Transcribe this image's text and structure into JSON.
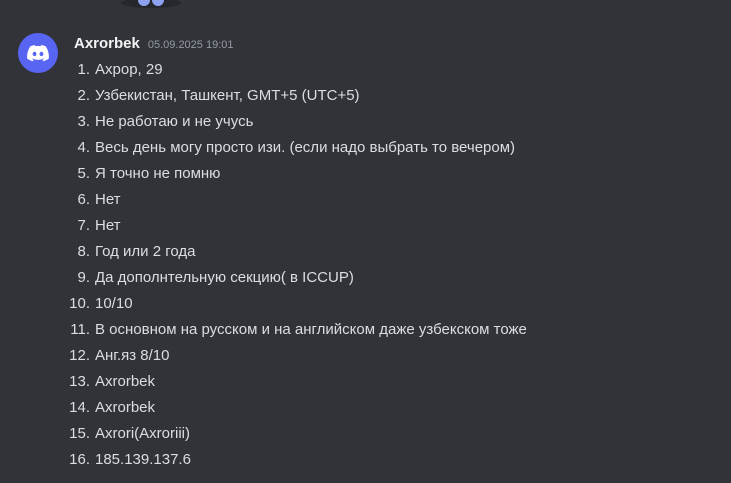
{
  "message": {
    "author": "Axrorbek",
    "timestamp": "05.09.2025 19:01",
    "avatar_icon": "discord-logo-icon",
    "avatar_color": "#5865f2",
    "answers": [
      {
        "number": "1.",
        "text": "Ахрор, 29"
      },
      {
        "number": "2.",
        "text": "Узбекистан, Ташкент, GMT+5 (UTC+5)"
      },
      {
        "number": "3.",
        "text": "Не работаю и не учусь"
      },
      {
        "number": "4.",
        "text": "Весь день могу просто изи. (если надо выбрать то вечером)"
      },
      {
        "number": "5.",
        "text": "Я точно не помню"
      },
      {
        "number": "6.",
        "text": "Нет"
      },
      {
        "number": "7.",
        "text": "Нет"
      },
      {
        "number": "8.",
        "text": "Год или 2 года"
      },
      {
        "number": "9.",
        "text": "Да дополнтельную секцию( в ICCUP)"
      },
      {
        "number": "10.",
        "text": "10/10"
      },
      {
        "number": "11.",
        "text": "В основном на русском и на английском даже узбекском тоже"
      },
      {
        "number": "12.",
        "text": "Анг.яз 8/10"
      },
      {
        "number": "13.",
        "text": "Axrorbek"
      },
      {
        "number": "14.",
        "text": "Axrorbek"
      },
      {
        "number": "15.",
        "text": "Axrori(Axroriii)"
      },
      {
        "number": "16.",
        "text": "185.139.137.6"
      }
    ]
  },
  "colors": {
    "background": "#323339",
    "username": "#f2f3f5",
    "timestamp": "#949ba4",
    "text": "#dbdee1"
  }
}
